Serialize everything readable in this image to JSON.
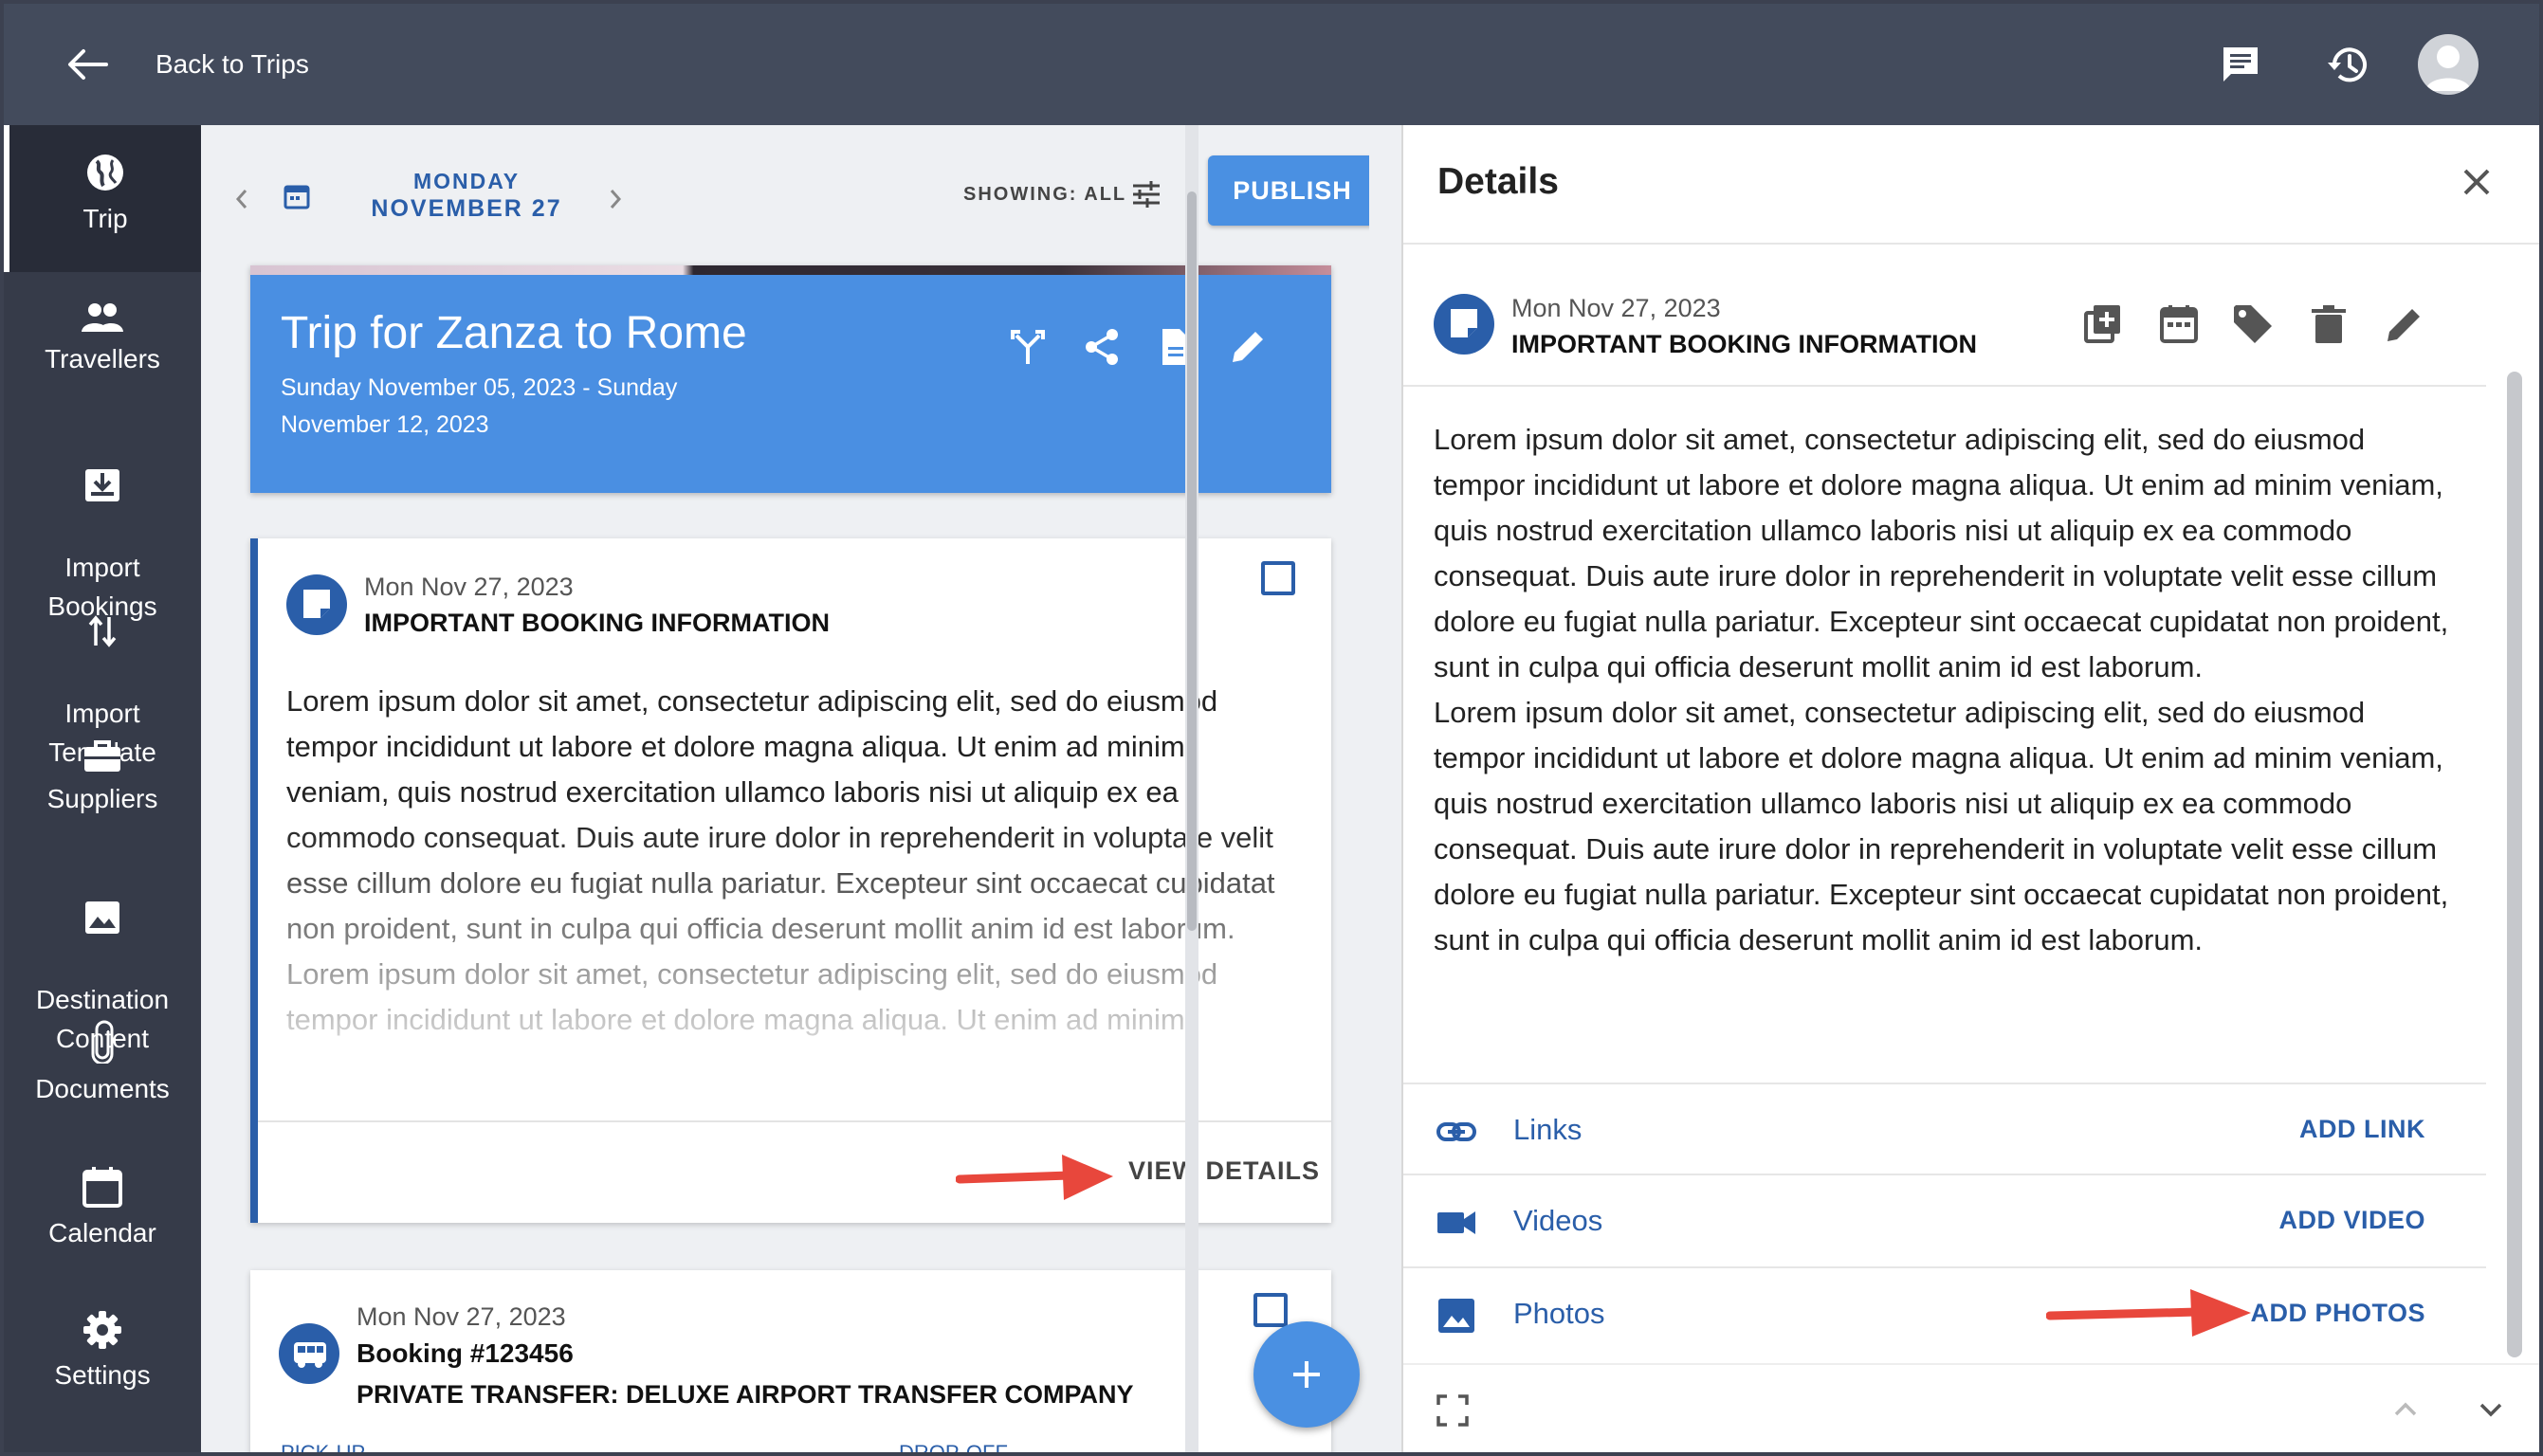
{
  "topbar": {
    "back_label": "Back to Trips"
  },
  "nav": [
    {
      "label": "Trip",
      "icon": "globe-icon"
    },
    {
      "label": "Travellers",
      "icon": "people-icon"
    },
    {
      "label": "Import\nBookings",
      "icon": "import-icon"
    },
    {
      "label": "Import\nTemplate",
      "icon": "swap-vertical-icon"
    },
    {
      "label": "Suppliers",
      "icon": "briefcase-icon"
    },
    {
      "label": "Destination\nContent",
      "icon": "image-icon"
    },
    {
      "label": "Documents",
      "icon": "paperclip-icon"
    },
    {
      "label": "Calendar",
      "icon": "calendar-icon"
    },
    {
      "label": "Settings",
      "icon": "gear-icon"
    }
  ],
  "datebar": {
    "day": "MONDAY",
    "date": "NOVEMBER 27",
    "showing": "SHOWING: ALL",
    "publish": "PUBLISH"
  },
  "trip": {
    "title": "Trip for Zanza to Rome",
    "dates_line1": "Sunday November 05, 2023 - Sunday",
    "dates_line2": "November 12, 2023"
  },
  "card1": {
    "date": "Mon Nov 27, 2023",
    "title": "IMPORTANT BOOKING INFORMATION",
    "para1": "Lorem ipsum dolor sit amet, consectetur adipiscing elit, sed do eiusmod tempor incididunt ut labore et dolore magna aliqua. Ut enim ad minim veniam, quis nostrud exercitation ullamco laboris nisi ut aliquip ex ea commodo consequat. Duis aute irure dolor in reprehenderit in voluptate velit esse cillum dolore eu fugiat nulla pariatur. Excepteur sint occaecat cupidatat non proident, sunt in culpa qui officia deserunt mollit anim id est laborum.",
    "para2": "Lorem ipsum dolor sit amet, consectetur adipiscing elit, sed do eiusmod tempor incididunt ut labore et dolore magna aliqua. Ut enim ad minim",
    "view_details": "VIEW DETAILS"
  },
  "card2": {
    "date": "Mon Nov 27, 2023",
    "booking": "Booking #123456",
    "title": "PRIVATE TRANSFER: DELUXE AIRPORT TRANSFER COMPANY",
    "pickup": "PICK-UP",
    "dropoff": "DROP-OFF"
  },
  "details": {
    "heading": "Details",
    "date": "Mon Nov 27, 2023",
    "title": "IMPORTANT BOOKING INFORMATION",
    "para1": "Lorem ipsum dolor sit amet, consectetur adipiscing elit, sed do eiusmod tempor incididunt ut labore et dolore magna aliqua. Ut enim ad minim veniam, quis nostrud exercitation ullamco laboris nisi ut aliquip ex ea commodo consequat. Duis aute irure dolor in reprehenderit in voluptate velit esse cillum dolore eu fugiat nulla pariatur. Excepteur sint occaecat cupidatat non proident, sunt in culpa qui officia deserunt mollit anim id est laborum.",
    "para2": "Lorem ipsum dolor sit amet, consectetur adipiscing elit, sed do eiusmod tempor incididunt ut labore et dolore magna aliqua. Ut enim ad minim veniam, quis nostrud exercitation ullamco laboris nisi ut aliquip ex ea commodo consequat. Duis aute irure dolor in reprehenderit in voluptate velit esse cillum dolore eu fugiat nulla pariatur. Excepteur sint occaecat cupidatat non proident, sunt in culpa qui officia deserunt mollit anim id est laborum.",
    "links_label": "Links",
    "links_action": "ADD LINK",
    "videos_label": "Videos",
    "videos_action": "ADD VIDEO",
    "photos_label": "Photos",
    "photos_action": "ADD PHOTOS"
  },
  "colors": {
    "primary": "#2a5ea9",
    "accent": "#4a90e2",
    "topbar": "#434b5c",
    "sidebar": "#363b49",
    "arrow": "#e8473c"
  }
}
